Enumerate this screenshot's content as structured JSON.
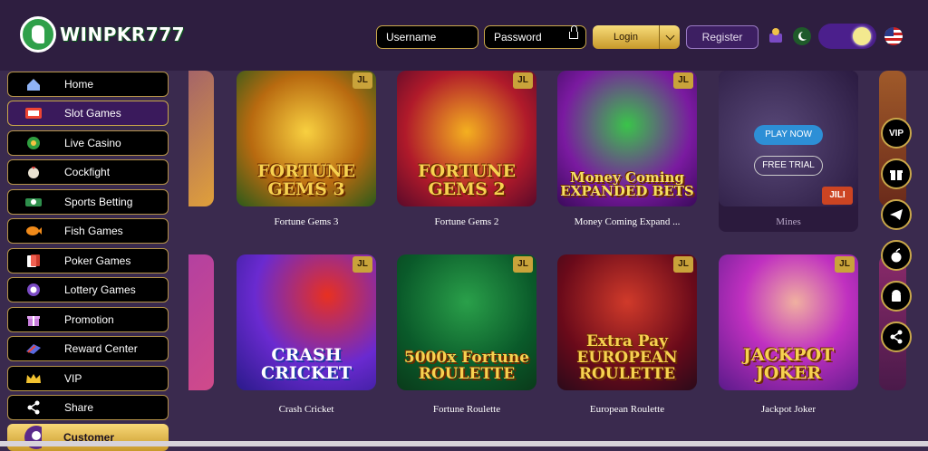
{
  "header": {
    "logo_text": "WINPKR777",
    "username_placeholder": "Username",
    "password_placeholder": "Password",
    "login_label": "Login",
    "register_label": "Register"
  },
  "sidebar": {
    "items": [
      {
        "label": "Home",
        "icon": "home-icon"
      },
      {
        "label": "Slot Games",
        "icon": "slot-machine-icon",
        "active": true
      },
      {
        "label": "Live Casino",
        "icon": "roulette-icon"
      },
      {
        "label": "Cockfight",
        "icon": "rooster-icon"
      },
      {
        "label": "Sports Betting",
        "icon": "sports-icon"
      },
      {
        "label": "Fish Games",
        "icon": "fish-icon"
      },
      {
        "label": "Poker Games",
        "icon": "cards-icon"
      },
      {
        "label": "Lottery Games",
        "icon": "lottery-ball-icon"
      },
      {
        "label": "Promotion",
        "icon": "gift-icon"
      },
      {
        "label": "Reward Center",
        "icon": "reward-icon"
      },
      {
        "label": "VIP",
        "icon": "crown-icon"
      },
      {
        "label": "Share",
        "icon": "share-icon"
      },
      {
        "label": "Customer",
        "icon": "support-icon"
      }
    ]
  },
  "games": [
    {
      "name": "Fortune Gems 3",
      "art": "FORTUNE GEMS 3"
    },
    {
      "name": "Fortune Gems 2",
      "art": "FORTUNE GEMS 2"
    },
    {
      "name": "Money Coming Expand ...",
      "art": "Money Coming EXPANDED BETS"
    },
    {
      "name": "Mines",
      "art": ""
    },
    {
      "name": "Crash Cricket",
      "art": "CRASH CRICKET"
    },
    {
      "name": "Fortune Roulette",
      "art": "5000x Fortune ROULETTE"
    },
    {
      "name": "European Roulette",
      "art": "Extra Pay EUROPEAN ROULETTE"
    },
    {
      "name": "Jackpot Joker",
      "art": "JACKPOT JOKER"
    }
  ],
  "mines_overlay": {
    "play_label": "PLAY NOW",
    "trial_label": "FREE TRIAL",
    "provider": "JILI"
  },
  "provider_badge": "JL",
  "floating": [
    "VIP",
    "gift",
    "telegram",
    "apple",
    "android",
    "share"
  ],
  "colors": {
    "accent_gold": "#c9a74a",
    "background": "#3a2a4e",
    "header": "#2e1e40"
  }
}
